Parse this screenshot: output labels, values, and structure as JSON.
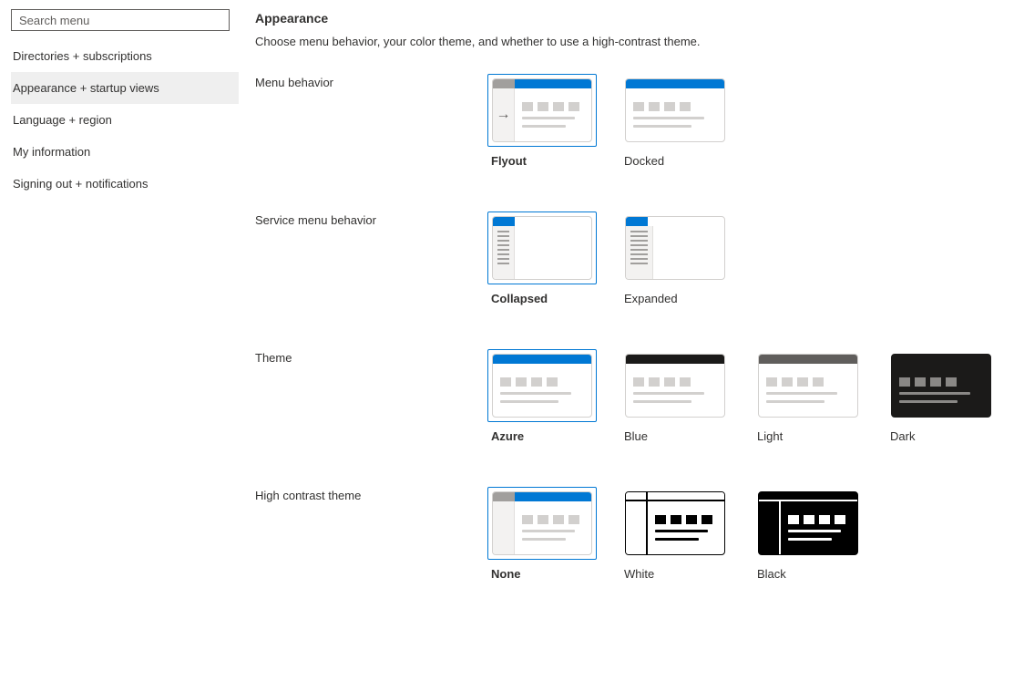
{
  "sidebar": {
    "searchPlaceholder": "Search menu",
    "items": [
      {
        "label": "Directories + subscriptions",
        "active": false
      },
      {
        "label": "Appearance + startup views",
        "active": true
      },
      {
        "label": "Language + region",
        "active": false
      },
      {
        "label": "My information",
        "active": false
      },
      {
        "label": "Signing out + notifications",
        "active": false
      }
    ]
  },
  "page": {
    "title": "Appearance",
    "description": "Choose menu behavior, your color theme, and whether to use a high-contrast theme."
  },
  "menuBehavior": {
    "label": "Menu behavior",
    "options": [
      {
        "label": "Flyout",
        "selected": true
      },
      {
        "label": "Docked",
        "selected": false
      }
    ]
  },
  "serviceMenuBehavior": {
    "label": "Service menu behavior",
    "options": [
      {
        "label": "Collapsed",
        "selected": true
      },
      {
        "label": "Expanded",
        "selected": false
      }
    ]
  },
  "theme": {
    "label": "Theme",
    "options": [
      {
        "label": "Azure",
        "selected": true,
        "topColor": "#0078d4"
      },
      {
        "label": "Blue",
        "selected": false,
        "topColor": "#1b1a19"
      },
      {
        "label": "Light",
        "selected": false,
        "topColor": "#605e5c"
      },
      {
        "label": "Dark",
        "selected": false,
        "topColor": "#1b1a19"
      }
    ]
  },
  "highContrast": {
    "label": "High contrast theme",
    "options": [
      {
        "label": "None",
        "selected": true
      },
      {
        "label": "White",
        "selected": false
      },
      {
        "label": "Black",
        "selected": false
      }
    ]
  }
}
